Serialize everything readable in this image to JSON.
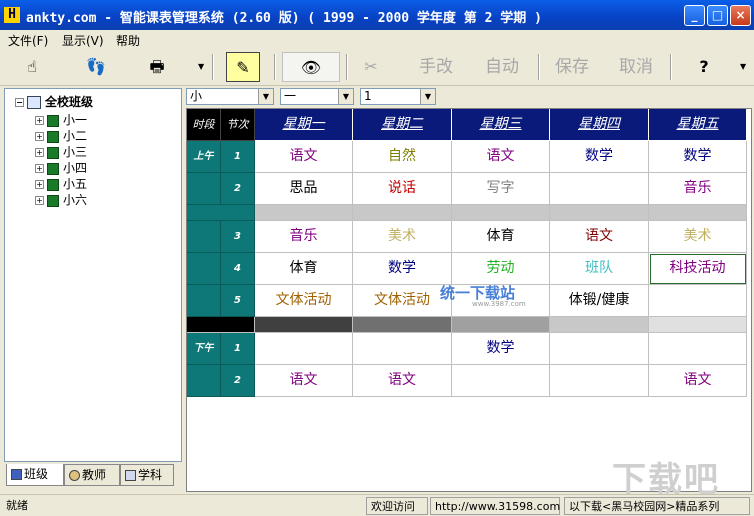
{
  "window": {
    "title": "ankty.com - 智能课表管理系统 (2.60 版) ( 1999 - 2000 学年度 第 2 学期 )",
    "minimize_label": "_",
    "maximize_label": "□",
    "close_label": "×"
  },
  "menu": {
    "items": [
      "文件(F)",
      "显示(V)",
      "帮助"
    ]
  },
  "toolbar": {
    "buttons": [
      {
        "name": "hand-icon",
        "glyph": "☝"
      },
      {
        "name": "footprints-icon",
        "glyph": "👣"
      },
      {
        "name": "printer-icon",
        "glyph": "🖶"
      },
      {
        "name": "teacher-board-icon",
        "glyph": "✎"
      },
      {
        "name": "eye-icon",
        "glyph": "👁"
      },
      {
        "name": "scissors-icon",
        "glyph": "✂"
      },
      {
        "name": "help-icon",
        "glyph": "?"
      }
    ],
    "text_buttons": [
      "手改",
      "自动",
      "保存",
      "取消"
    ]
  },
  "tree": {
    "root": "全校班级",
    "items": [
      "小一",
      "小二",
      "小三",
      "小四",
      "小五",
      "小六"
    ]
  },
  "bottom_tabs": [
    "班级",
    "教师",
    "学科"
  ],
  "combos": [
    "小",
    "一",
    "1"
  ],
  "timetable": {
    "corner": [
      "时段",
      "节次"
    ],
    "days": [
      "星期一",
      "星期二",
      "星期三",
      "星期四",
      "星期五"
    ],
    "session_labels": {
      "morning": "上午",
      "afternoon": "下午"
    },
    "rows": [
      {
        "period": "1",
        "cells": [
          {
            "t": "语文",
            "c": "#800080"
          },
          {
            "t": "自然",
            "c": "#808000"
          },
          {
            "t": "语文",
            "c": "#800080"
          },
          {
            "t": "数学",
            "c": "#000080"
          },
          {
            "t": "数学",
            "c": "#000080"
          }
        ]
      },
      {
        "period": "2",
        "cells": [
          {
            "t": "思品",
            "c": "#000000"
          },
          {
            "t": "说话",
            "c": "#c00000"
          },
          {
            "t": "写字",
            "c": "#808080"
          },
          {
            "t": "",
            "c": "#000"
          },
          {
            "t": "音乐",
            "c": "#800080"
          }
        ]
      },
      {
        "period": "3",
        "cells": [
          {
            "t": "音乐",
            "c": "#800080"
          },
          {
            "t": "美术",
            "c": "#c0b060"
          },
          {
            "t": "体育",
            "c": "#000000"
          },
          {
            "t": "语文",
            "c": "#800000"
          },
          {
            "t": "美术",
            "c": "#c0b060"
          }
        ]
      },
      {
        "period": "4",
        "cells": [
          {
            "t": "体育",
            "c": "#000000"
          },
          {
            "t": "数学",
            "c": "#000080"
          },
          {
            "t": "劳动",
            "c": "#20b020"
          },
          {
            "t": "班队",
            "c": "#40c0c0"
          },
          {
            "t": "科技活动",
            "c": "#800080"
          }
        ]
      },
      {
        "period": "5",
        "cells": [
          {
            "t": "文体活动",
            "c": "#a06000"
          },
          {
            "t": "文体活动",
            "c": "#a06000"
          },
          {
            "t": "",
            "c": "#000"
          },
          {
            "t": "体锻/健康",
            "c": "#000000"
          },
          {
            "t": "",
            "c": "#000"
          }
        ]
      },
      {
        "period": "1",
        "cells": [
          {
            "t": "",
            "c": "#000"
          },
          {
            "t": "",
            "c": "#000"
          },
          {
            "t": "数学",
            "c": "#000080"
          },
          {
            "t": "",
            "c": "#000"
          },
          {
            "t": "",
            "c": "#000"
          }
        ]
      },
      {
        "period": "2",
        "cells": [
          {
            "t": "语文",
            "c": "#800080"
          },
          {
            "t": "语文",
            "c": "#800080"
          },
          {
            "t": "",
            "c": "#000"
          },
          {
            "t": "",
            "c": "#000"
          },
          {
            "t": "语文",
            "c": "#800080"
          }
        ]
      }
    ]
  },
  "watermark": {
    "text": "统一下载站",
    "sub": "www.3987.com"
  },
  "logo_text": "下载吧",
  "status": {
    "ready": "就绪",
    "welcome": "欢迎访问",
    "url": "http://www.31598.com",
    "download": "以下载<黑马校园网>精品系列"
  }
}
